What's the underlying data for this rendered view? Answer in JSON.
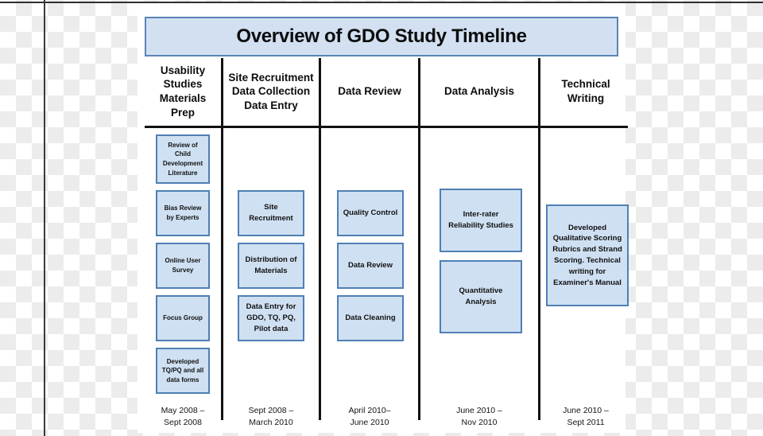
{
  "figure": {
    "title": "Overview of GDO Study Timeline",
    "accent_fill": "#cfe0f2",
    "accent_border": "#4f7fb3",
    "banner_fill": "#d2e0f1",
    "banner_border": "#5b85b5",
    "rule_color": "#121212"
  },
  "columns": [
    {
      "id": "usability-studies-materials-prep",
      "header": "Usability Studies Materials Prep",
      "dates": "May 2008 –\nSept 2008",
      "nodes": [
        {
          "label": "Review  of Child Development Literature",
          "size": "sm"
        },
        {
          "label": "Bias Review by Experts",
          "size": "sm"
        },
        {
          "label": "Online User Survey",
          "size": "sm"
        },
        {
          "label": "Focus Group",
          "size": "sm"
        },
        {
          "label": "Developed TQ/PQ and all data forms",
          "size": "sm"
        }
      ]
    },
    {
      "id": "site-recruitment-data-collection-data-entry",
      "header": "Site Recruitment Data Collection Data Entry",
      "dates": "Sept 2008 –\nMarch 2010",
      "nodes": [
        {
          "label": "Site Recruitment",
          "size": "med"
        },
        {
          "label": "Distribution of Materials",
          "size": "med"
        },
        {
          "label": "Data Entry for GDO, TQ, PQ, Pilot data",
          "size": "med"
        }
      ]
    },
    {
      "id": "data-review",
      "header": "Data Review",
      "dates": "April  2010–\nJune 2010",
      "nodes": [
        {
          "label": "Quality Control",
          "size": "med"
        },
        {
          "label": "Data Review",
          "size": "med"
        },
        {
          "label": "Data Cleaning",
          "size": "med"
        }
      ]
    },
    {
      "id": "data-analysis",
      "header": "Data Analysis",
      "dates": "June 2010 –\nNov 2010",
      "nodes": [
        {
          "label": "Inter-rater Reliability Studies",
          "size": "med"
        },
        {
          "label": "Quantitative Analysis",
          "size": "med"
        }
      ]
    },
    {
      "id": "technical-writing",
      "header": "Technical Writing",
      "dates": "June 2010 –\nSept 2011",
      "nodes": [
        {
          "label": "Developed Qualitative Scoring Rubrics and Strand Scoring.  Technical writing for Examiner's Manual",
          "size": "med"
        }
      ]
    }
  ]
}
